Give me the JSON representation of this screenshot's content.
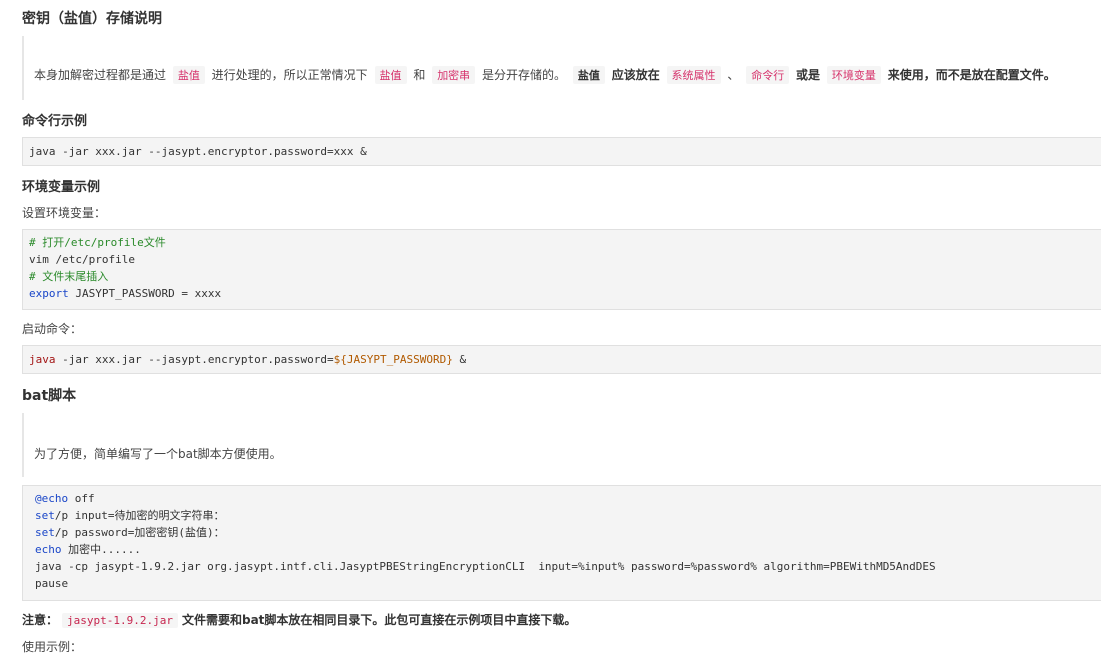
{
  "sections": {
    "heading_key": "密钥（盐值）存储说明",
    "quote1": {
      "t1": "本身加解密过程都是通过",
      "tag1": "盐值",
      "t2": "进行处理的，所以正常情况下",
      "tag2": "盐值",
      "t3": "和",
      "tag3": "加密串",
      "t4": "是分开存储的。",
      "tag4": "盐值",
      "t5": "应该放在",
      "tag5": "系统属性",
      "t6": "、",
      "tag6": "命令行",
      "t7": "或是",
      "tag7": "环境变量",
      "t8": "来使用，而不是放在配置文件。"
    },
    "heading_cli": "命令行示例",
    "code_cli": "java -jar xxx.jar --jasypt.encryptor.password=xxx &",
    "heading_env": "环境变量示例",
    "env_label": "设置环境变量：",
    "code_env": {
      "l1": "# 打开/etc/profile文件",
      "l2": "vim /etc/profile",
      "l3": "# 文件末尾插入",
      "l4_kw": "export",
      "l4_rest": " JASYPT_PASSWORD = xxxx"
    },
    "start_label": "启动命令：",
    "code_start": {
      "kw": "java",
      "mid": " -jar xxx.jar --jasypt.encryptor.password=",
      "var": "${JASYPT_PASSWORD}",
      "end": " &"
    },
    "heading_bat": "bat脚本",
    "quote2": "为了方便，简单编写了一个bat脚本方便使用。",
    "code_bat": {
      "l1_kw": "@echo",
      "l1_rest": " off",
      "l2_kw": "set",
      "l2_rest": "/p input=待加密的明文字符串：",
      "l3_kw": "set",
      "l3_rest": "/p password=加密密钥(盐值)：",
      "l4_kw": "echo",
      "l4_rest": " 加密中......",
      "l5": "java -cp jasypt-1.9.2.jar org.jasypt.intf.cli.JasyptPBEStringEncryptionCLI  input=%input% password=%password% algorithm=PBEWithMD5AndDES",
      "l6": "pause"
    },
    "note": {
      "label": "注意：",
      "code": "jasypt-1.9.2.jar",
      "text": "文件需要和bat脚本放在相同目录下。此包可直接在示例项目中直接下载。"
    },
    "usage_label": "使用示例："
  },
  "colors": {
    "tag_text": "#d6336c",
    "comment": "#2a8a2a",
    "keyword": "#1a46c8",
    "code_bg": "#f4f4f4"
  }
}
